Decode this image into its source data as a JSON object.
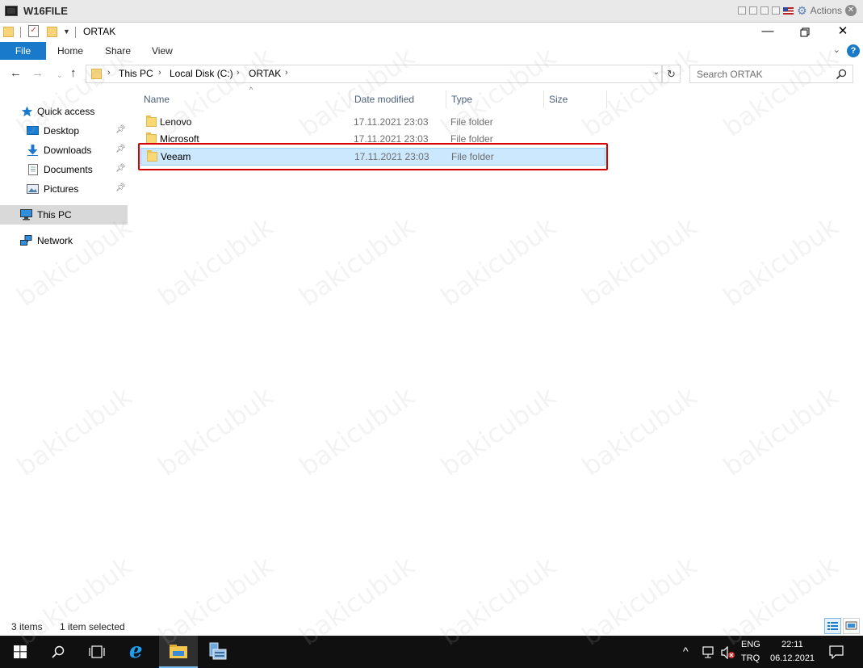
{
  "vm": {
    "title": "W16FILE",
    "actions_label": "Actions"
  },
  "explorer": {
    "window_title": "ORTAK",
    "ribbon": {
      "tabs": [
        "File",
        "Home",
        "Share",
        "View"
      ],
      "help_label": "?"
    },
    "address": {
      "crumbs": [
        "This PC",
        "Local Disk (C:)",
        "ORTAK"
      ]
    },
    "search": {
      "placeholder": "Search ORTAK"
    },
    "navpane": {
      "items": [
        {
          "label": "Quick access",
          "icon": "star-icon"
        },
        {
          "label": "Desktop",
          "icon": "desktop-icon",
          "pinned": true
        },
        {
          "label": "Downloads",
          "icon": "download-arrow-icon",
          "pinned": true
        },
        {
          "label": "Documents",
          "icon": "documents-icon",
          "pinned": true
        },
        {
          "label": "Pictures",
          "icon": "pictures-icon",
          "pinned": true
        },
        {
          "label": "This PC",
          "icon": "computer-icon",
          "selected": true
        },
        {
          "label": "Network",
          "icon": "network-icon"
        }
      ]
    },
    "columns": {
      "name": "Name",
      "date": "Date modified",
      "type": "Type",
      "size": "Size"
    },
    "rows": [
      {
        "name": "Lenovo",
        "date": "17.11.2021 23:03",
        "type": "File folder",
        "size": "",
        "selected": false
      },
      {
        "name": "Microsoft",
        "date": "17.11.2021 23:03",
        "type": "File folder",
        "size": "",
        "selected": false
      },
      {
        "name": "Veeam",
        "date": "17.11.2021 23:03",
        "type": "File folder",
        "size": "",
        "selected": true
      }
    ],
    "status": {
      "item_count": "3 items",
      "selection": "1 item selected"
    }
  },
  "taskbar": {
    "lang_line1": "ENG",
    "lang_line2": "TRQ",
    "time": "22:11",
    "date": "06.12.2021"
  },
  "watermark": "bakicubuk",
  "colors": {
    "accent": "#1979ca",
    "selection_bg": "#cce8ff",
    "selection_border": "#99d1ff",
    "highlight_box": "#d40000",
    "folder": "#f8d775"
  }
}
